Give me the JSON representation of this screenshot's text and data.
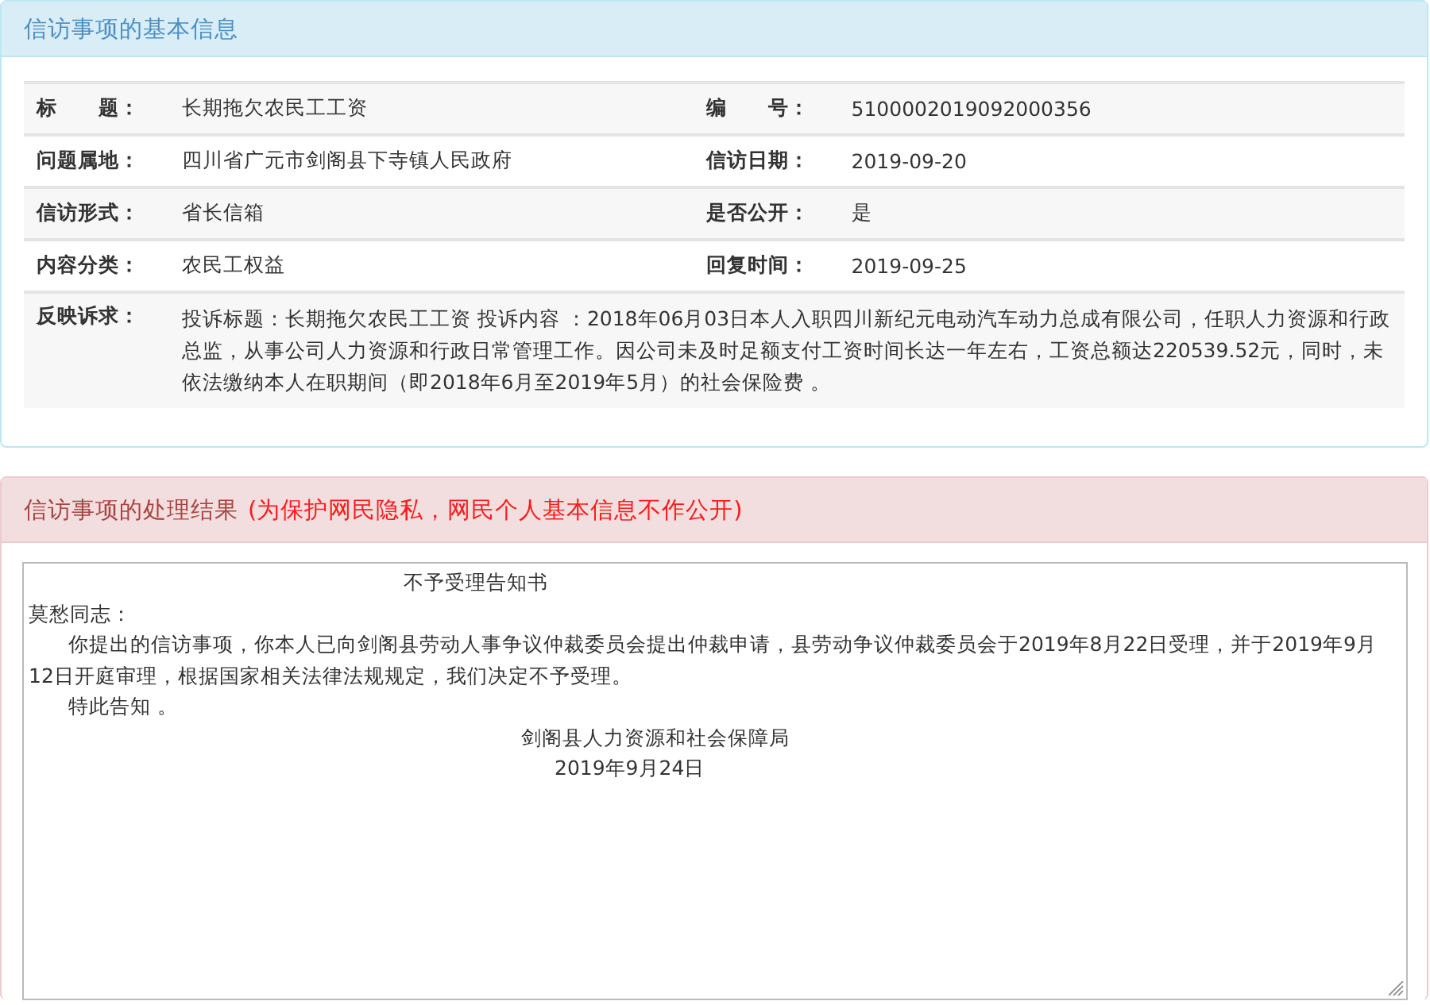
{
  "info_panel": {
    "title": "信访事项的基本信息",
    "rows": [
      {
        "cells": [
          {
            "label": "标　　题：",
            "value": "长期拖欠农民工工资"
          },
          {
            "label": "编　　号：",
            "value": "5100002019092000356"
          }
        ]
      },
      {
        "cells": [
          {
            "label": "问题属地：",
            "value": "四川省广元市剑阁县下寺镇人民政府"
          },
          {
            "label": "信访日期：",
            "value": "2019-09-20"
          }
        ]
      },
      {
        "cells": [
          {
            "label": "信访形式：",
            "value": "省长信箱"
          },
          {
            "label": "是否公开：",
            "value": "是"
          }
        ]
      },
      {
        "cells": [
          {
            "label": "内容分类：",
            "value": "农民工权益"
          },
          {
            "label": "回复时间：",
            "value": "2019-09-25"
          }
        ]
      },
      {
        "cells": [
          {
            "label": "反映诉求：",
            "value": "投诉标题：长期拖欠农民工工资 投诉内容 ：2018年06月03日本人入职四川新纪元电动汽车动力总成有限公司，任职人力资源和行政总监，从事公司人力资源和行政日常管理工作。因公司未及时足额支付工资时间长达一年左右，工资总额达220539.52元，同时，未依法缴纳本人在职期间（即2018年6月至2019年5月）的社会保险费 。"
          }
        ]
      }
    ]
  },
  "result_panel": {
    "title": "信访事项的处理结果",
    "note": "(为保护网民隐私，网民个人基本信息不作公开)",
    "text_lines": [
      {
        "kind": "title",
        "text": "不予受理告知书"
      },
      {
        "kind": "greeting",
        "text": "莫愁同志："
      },
      {
        "kind": "paragraph",
        "text": "你提出的信访事项，你本人已向剑阁县劳动人事争议仲裁委员会提出仲裁申请，县劳动争议仲裁委员会于2019年8月22日受理，并于2019年9月12日开庭审理，根据国家相关法律法规规定，我们决定不予受理。"
      },
      {
        "kind": "paragraph",
        "text": "特此告知 。"
      },
      {
        "kind": "signature",
        "text": "剑阁县人力资源和社会保障局"
      },
      {
        "kind": "date",
        "text": "2019年9月24日"
      }
    ]
  }
}
